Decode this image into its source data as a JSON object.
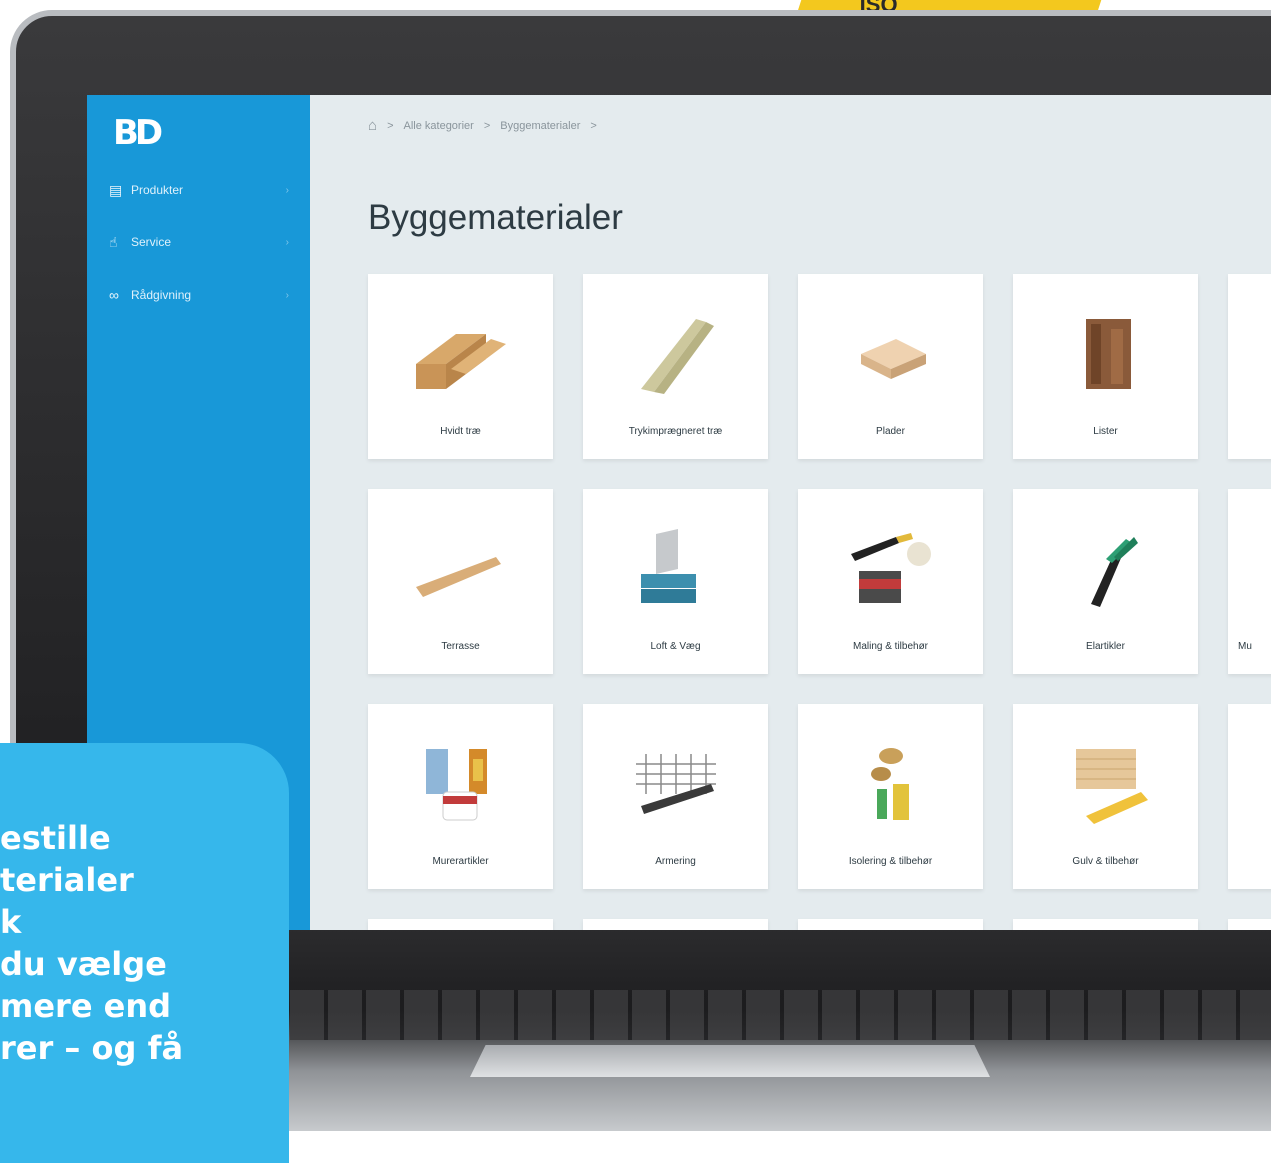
{
  "background": {
    "package_text": "ISO"
  },
  "sidebar": {
    "logo": "BD",
    "items": [
      {
        "label": "Produkter",
        "icon": "shelves-icon"
      },
      {
        "label": "Service",
        "icon": "thumbs-up-icon"
      },
      {
        "label": "Rådgivning",
        "icon": "glasses-icon"
      }
    ]
  },
  "breadcrumb": {
    "items": [
      "Alle kategorier",
      "Byggematerialer"
    ]
  },
  "page": {
    "title": "Byggematerialer"
  },
  "categories": [
    {
      "label": "Hvidt træ"
    },
    {
      "label": "Trykimprægneret træ"
    },
    {
      "label": "Plader"
    },
    {
      "label": "Lister"
    },
    {
      "label": ""
    },
    {
      "label": "Terrasse"
    },
    {
      "label": "Loft & Væg"
    },
    {
      "label": "Maling & tilbehør"
    },
    {
      "label": "Elartikler"
    },
    {
      "label": "Mu"
    },
    {
      "label": "Murerartikler"
    },
    {
      "label": "Armering"
    },
    {
      "label": "Isolering & tilbehør"
    },
    {
      "label": "Gulv & tilbehør"
    },
    {
      "label": ""
    }
  ],
  "callout": {
    "text": "estille\nterialer\nk\ndu vælge\nmere end\nrer – og få"
  },
  "colors": {
    "sidebar": "#1898d8",
    "callout": "#36b7eb",
    "content_bg": "#e4ebee"
  }
}
